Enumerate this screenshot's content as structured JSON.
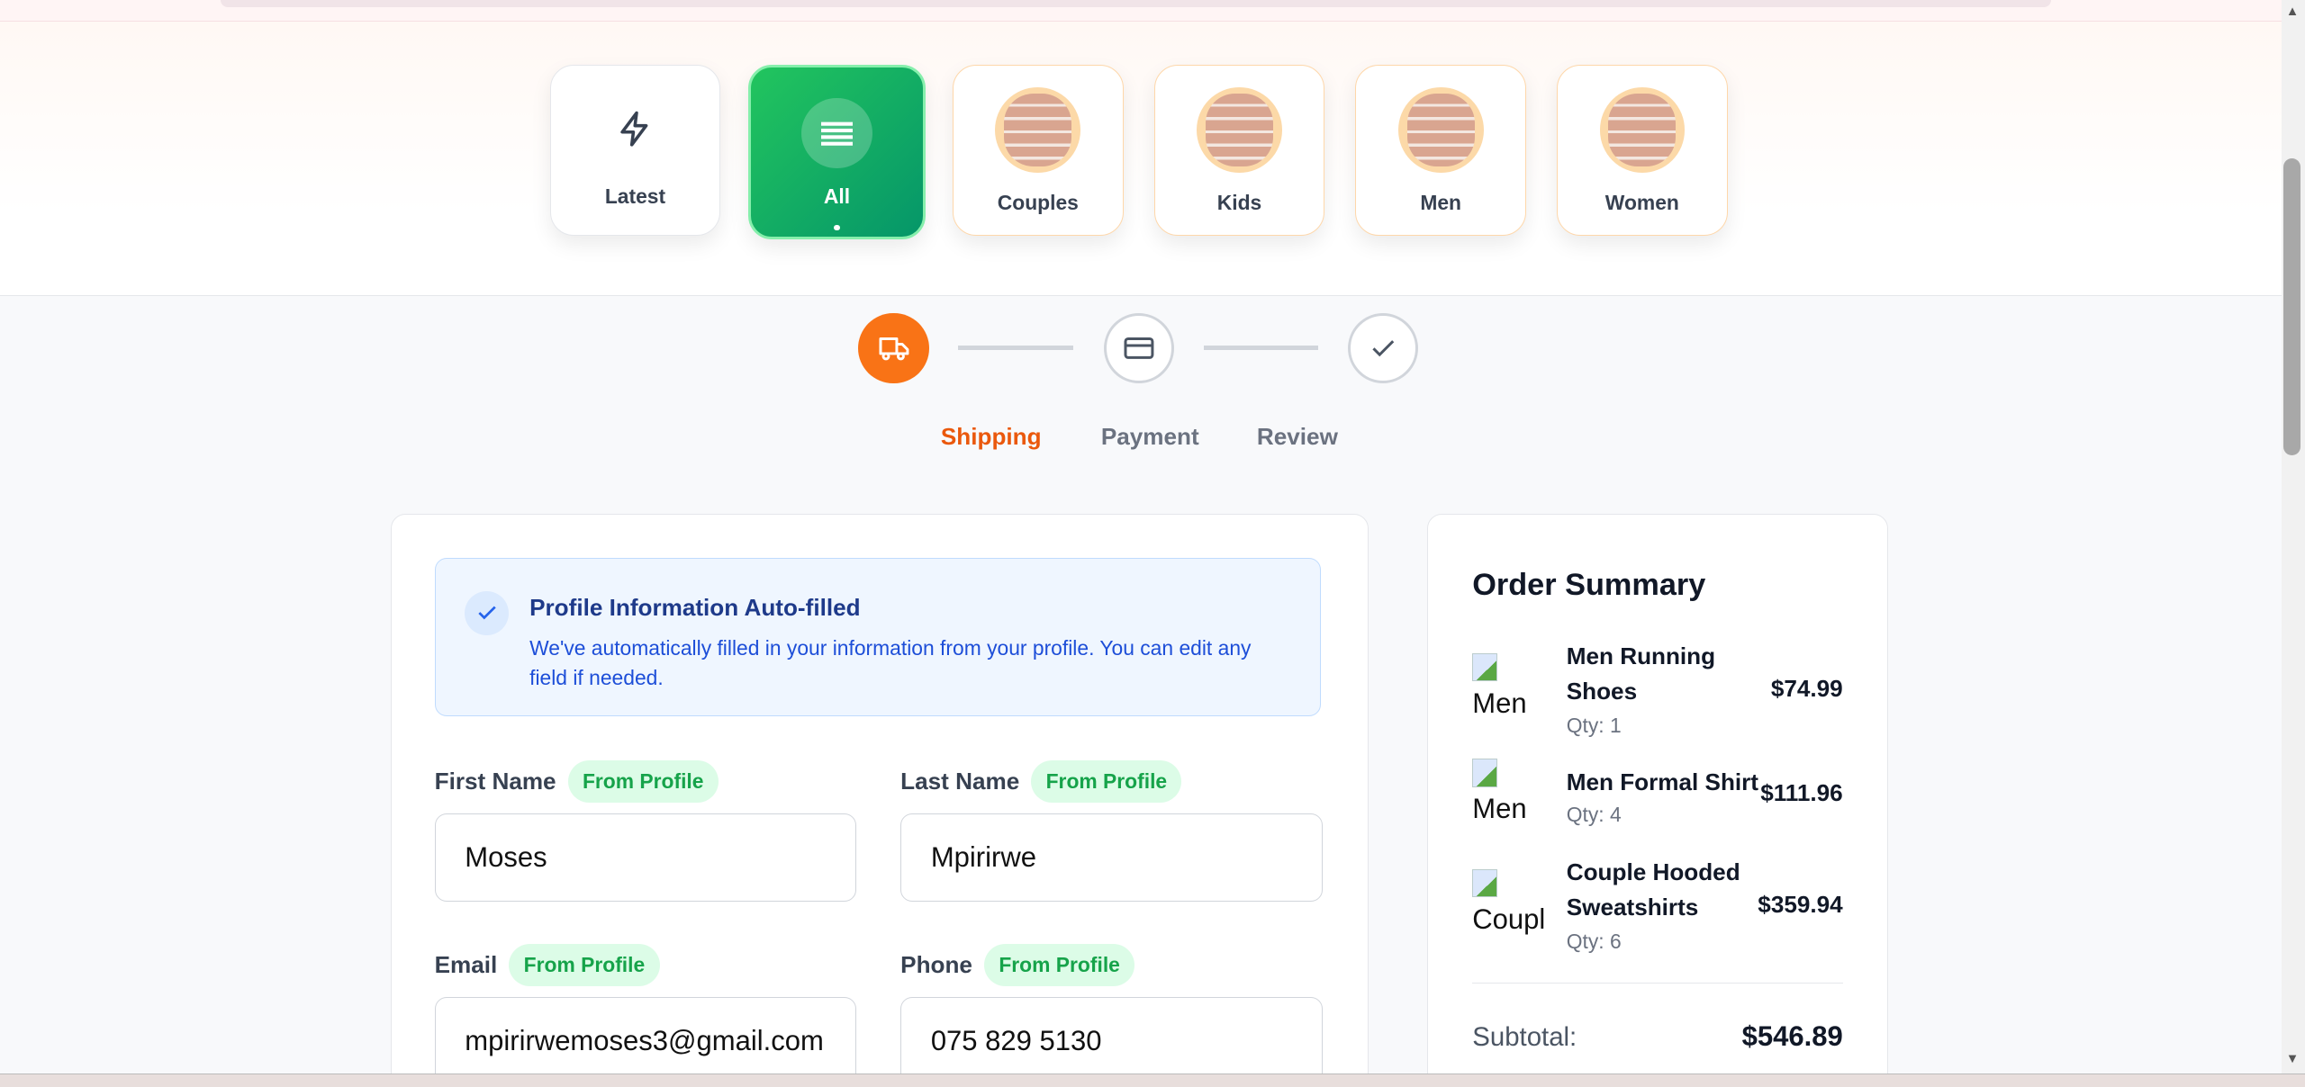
{
  "categories": [
    {
      "label": "Latest",
      "icon": "lightning-icon"
    },
    {
      "label": "All",
      "icon": "list-icon",
      "active": true
    },
    {
      "label": "Couples",
      "icon": "category-image"
    },
    {
      "label": "Kids",
      "icon": "category-image"
    },
    {
      "label": "Men",
      "icon": "category-image"
    },
    {
      "label": "Women",
      "icon": "category-image"
    }
  ],
  "stepper": {
    "steps": [
      {
        "label": "Shipping",
        "icon": "truck-icon",
        "active": true
      },
      {
        "label": "Payment",
        "icon": "credit-card-icon"
      },
      {
        "label": "Review",
        "icon": "check-icon"
      }
    ],
    "active_color": "#f97316"
  },
  "alert": {
    "title": "Profile Information Auto-filled",
    "text": "We've automatically filled in your information from your profile. You can edit any field if needed."
  },
  "form": {
    "badge": "From Profile",
    "first_name": {
      "label": "First Name",
      "value": "Moses"
    },
    "last_name": {
      "label": "Last Name",
      "value": "Mpirirwe"
    },
    "email": {
      "label": "Email",
      "value": "mpirirwemoses3@gmail.com"
    },
    "phone": {
      "label": "Phone",
      "value": "075 829 5130"
    }
  },
  "summary": {
    "title": "Order Summary",
    "items": [
      {
        "alt": "Men",
        "name": "Men Running Shoes",
        "qty": "Qty: 1",
        "price": "$74.99"
      },
      {
        "alt": "Men",
        "name": "Men Formal Shirt",
        "qty": "Qty: 4",
        "price": "$111.96"
      },
      {
        "alt": "Coupl",
        "name": "Couple Hooded Sweatshirts",
        "qty": "Qty: 6",
        "price": "$359.94"
      }
    ],
    "subtotal_label": "Subtotal:",
    "subtotal": "$546.89"
  }
}
